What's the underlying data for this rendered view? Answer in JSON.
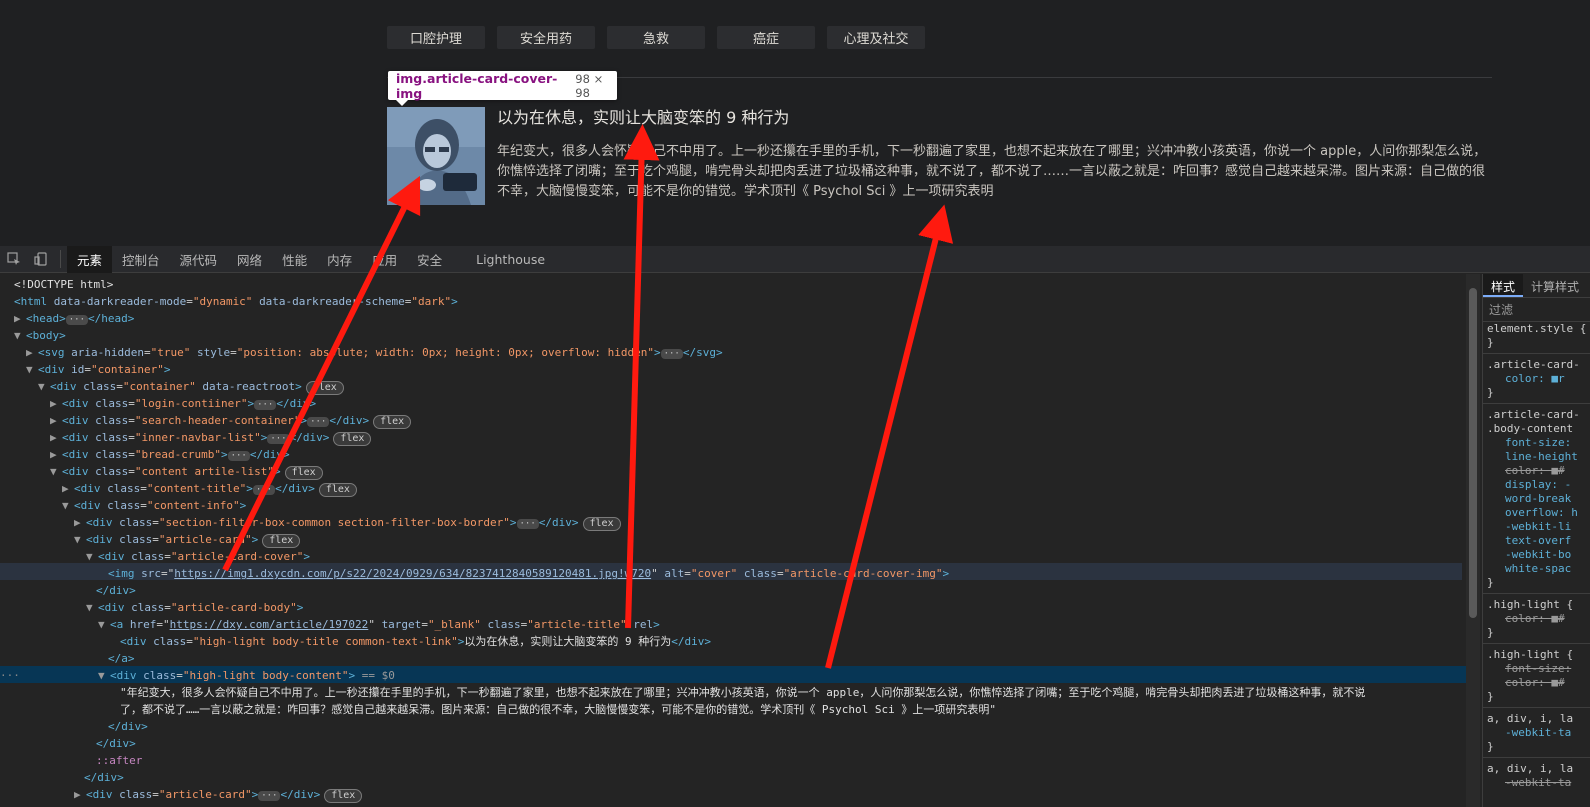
{
  "page": {
    "category_tabs": [
      "口腔护理",
      "安全用药",
      "急救",
      "癌症",
      "心理及社交"
    ],
    "tooltip": {
      "name": "img.article-card-cover-img",
      "size": "98 × 98"
    },
    "article": {
      "title": "以为在休息，实则让大脑变笨的 9 种行为",
      "description": "年纪变大，很多人会怀疑自己不中用了。上一秒还攥在手里的手机，下一秒翻遍了家里，也想不起来放在了哪里；兴冲冲教小孩英语，你说一个 apple，人问你那梨怎么说，你憔悴选择了闭嘴；至于吃个鸡腿，啃完骨头却把肉丢进了垃圾桶这种事，就不说了，都不说了……一言以蔽之就是：咋回事？感觉自己越来越呆滞。图片来源：自己做的很不幸，大脑慢慢变笨，可能不是你的错觉。学术顶刊《 Psychol Sci 》上一项研究表明"
    }
  },
  "devtools": {
    "tabs": [
      "元素",
      "控制台",
      "源代码",
      "网络",
      "性能",
      "内存",
      "应用",
      "安全",
      "Lighthouse"
    ],
    "active_tab": "元素",
    "badge_flex": "flex",
    "selected_suffix": "== $0",
    "dom": {
      "doctype": "<!DOCTYPE html>",
      "html_dm_attr": "data-darkreader-mode",
      "html_dm_val": "\"dynamic\"",
      "html_ds_attr": "data-darkreader-scheme",
      "html_ds_val": "\"dark\"",
      "svg_style": "\"position: absolute; width: 0px; height: 0px; overflow: hidden\"",
      "img_src": "https://img1.dxycdn.com/p/s22/2024/0929/634/8237412840589120481.jpg!w720",
      "a_href": "https://dxy.com/article/197022",
      "body_title_text": "以为在休息，实则让大脑变笨的 9 种行为",
      "content_line1": "\"年纪变大，很多人会怀疑自己不中用了。上一秒还攥在手里的手机，下一秒翻遍了家里，也想不起来放在了哪里；兴冲冲教小孩英语，你说一个 apple，人问你那梨怎么说，你憔悴选择了闭嘴；至于吃个鸡腿，啃完骨头却把肉丢进了垃圾桶这种事，就不说",
      "content_line2": "了，都不说了……一言以蔽之就是：咋回事？感觉自己越来越呆滞。图片来源：自己做的很不幸，大脑慢慢变笨，可能不是你的错觉。学术顶刊《 Psychol Sci 》上一项研究表明\"",
      "after": "::after"
    },
    "styles": {
      "tabs": [
        "样式",
        "计算样式"
      ],
      "filter": "过滤",
      "lines": [
        {
          "t": "element.style {",
          "k": "sel"
        },
        {
          "t": "}",
          "k": "sel"
        },
        {
          "t": ".article-card-",
          "k": "sel"
        },
        {
          "t": "color: ■r",
          "k": "prop"
        },
        {
          "t": "}",
          "k": "sel"
        },
        {
          "t": ".article-card-",
          "k": "sel"
        },
        {
          "t": ".body-content",
          "k": "sel"
        },
        {
          "t": "font-size:",
          "k": "prop"
        },
        {
          "t": "line-height",
          "k": "prop"
        },
        {
          "t": "color: ■#",
          "k": "strike"
        },
        {
          "t": "display: -",
          "k": "prop"
        },
        {
          "t": "word-break",
          "k": "prop"
        },
        {
          "t": "overflow: h",
          "k": "prop"
        },
        {
          "t": "-webkit-li",
          "k": "prop"
        },
        {
          "t": "text-overf",
          "k": "prop"
        },
        {
          "t": "-webkit-bo",
          "k": "prop"
        },
        {
          "t": "white-spac",
          "k": "prop"
        },
        {
          "t": "}",
          "k": "sel"
        },
        {
          "t": ".high-light {",
          "k": "sel"
        },
        {
          "t": "color: ■#",
          "k": "strike"
        },
        {
          "t": "}",
          "k": "sel"
        },
        {
          "t": ".high-light {",
          "k": "sel"
        },
        {
          "t": "font-size:",
          "k": "strike"
        },
        {
          "t": "color: ■#",
          "k": "strike"
        },
        {
          "t": "}",
          "k": "sel"
        },
        {
          "t": "a, div, i, la",
          "k": "sel"
        },
        {
          "t": "-webkit-ta",
          "k": "prop"
        },
        {
          "t": "}",
          "k": "sel"
        },
        {
          "t": "a, div, i, la",
          "k": "sel"
        },
        {
          "t": "-webkit-ta",
          "k": "strike"
        }
      ]
    }
  }
}
